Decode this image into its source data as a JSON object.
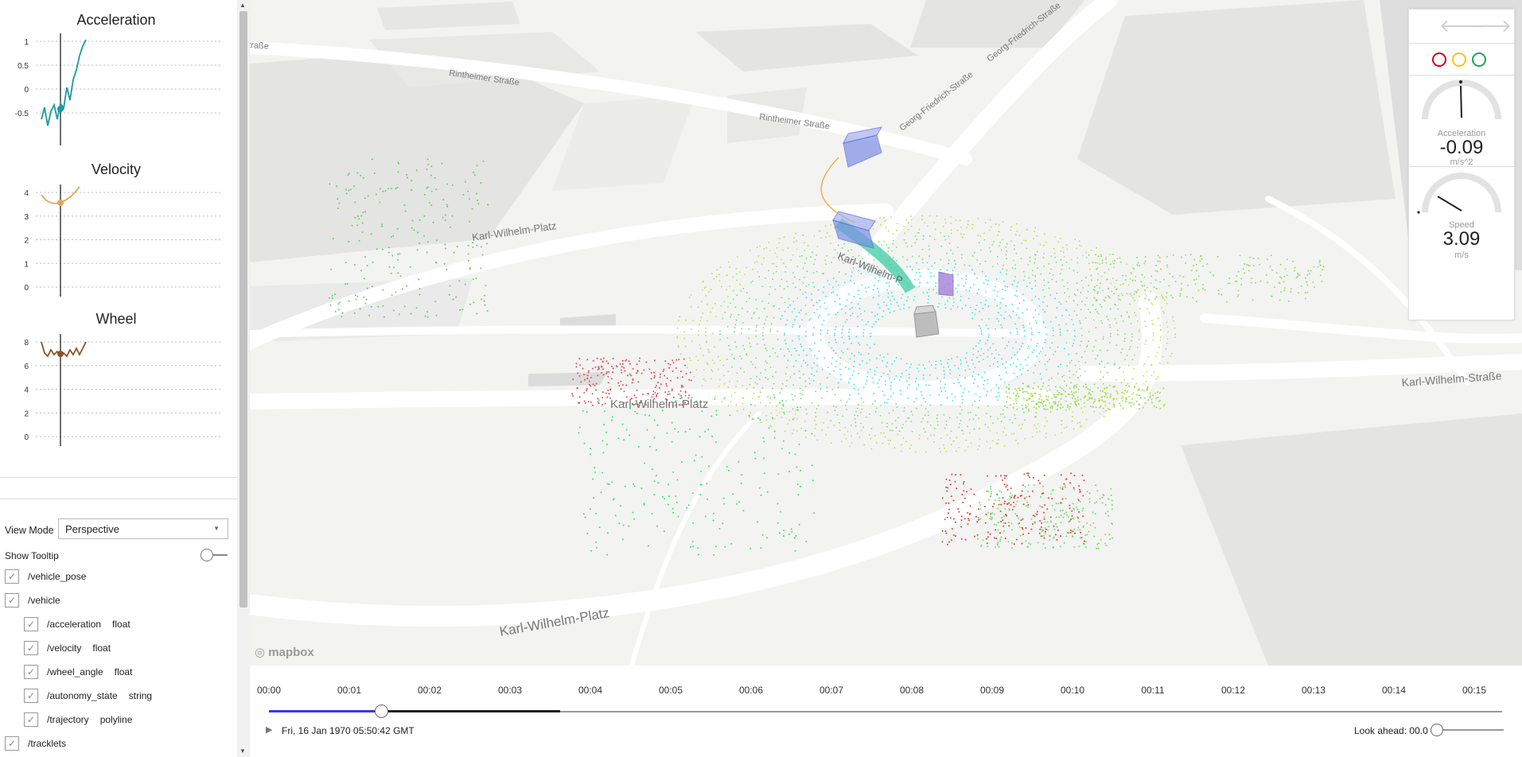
{
  "charts": [
    {
      "title": "Acceleration",
      "yticks": [
        "1",
        "0.5",
        "0",
        "-0.5"
      ],
      "color": "#1a9aa0"
    },
    {
      "title": "Velocity",
      "yticks": [
        "4",
        "3",
        "2",
        "1",
        "0"
      ],
      "color": "#e0a85e"
    },
    {
      "title": "Wheel",
      "yticks": [
        "8",
        "6",
        "4",
        "2",
        "0"
      ],
      "color": "#8b5428"
    }
  ],
  "controls": {
    "view_mode_label": "View Mode",
    "view_mode_value": "Perspective",
    "show_tooltip_label": "Show Tooltip",
    "streams": [
      {
        "name": "/vehicle_pose",
        "type": "",
        "checked": true,
        "indent": 0
      },
      {
        "name": "/vehicle",
        "type": "",
        "checked": true,
        "indent": 0
      },
      {
        "name": "/acceleration",
        "type": "float",
        "checked": true,
        "indent": 1
      },
      {
        "name": "/velocity",
        "type": "float",
        "checked": true,
        "indent": 1
      },
      {
        "name": "/wheel_angle",
        "type": "float",
        "checked": true,
        "indent": 1
      },
      {
        "name": "/autonomy_state",
        "type": "string",
        "checked": true,
        "indent": 1
      },
      {
        "name": "/trajectory",
        "type": "polyline",
        "checked": true,
        "indent": 1
      },
      {
        "name": "/tracklets",
        "type": "",
        "checked": true,
        "indent": 0
      }
    ]
  },
  "map": {
    "street_labels": [
      "Rintheimer Straße",
      "Rintheimer Straße",
      "Georg-Friedrich-Straße",
      "Georg-Friedrich-Straße",
      "Karl-Wilhelm-Platz",
      "Karl-Wilhelm-Platz",
      "Karl-Wilhelm-Platz",
      "Karl-Wilhelm-Straße",
      "Karl-Wilhelm-P",
      "traße"
    ],
    "attribution": "mapbox"
  },
  "hud": {
    "traffic_light_colors": [
      "#d0021b",
      "#f5c518",
      "#23a455"
    ],
    "acceleration_label": "Acceleration",
    "acceleration_value": "-0.09",
    "acceleration_unit": "m/s^2",
    "speed_label": "Speed",
    "speed_value": "3.09",
    "speed_unit": "m/s"
  },
  "timeline": {
    "ticks": [
      "00:00",
      "00:01",
      "00:02",
      "00:03",
      "00:04",
      "00:05",
      "00:06",
      "00:07",
      "00:08",
      "00:09",
      "00:10",
      "00:11",
      "00:12",
      "00:13",
      "00:14",
      "00:15"
    ],
    "current_time": "Fri, 16 Jan 1970 05:50:42 GMT",
    "look_ahead_label": "Look ahead: 00.0",
    "progress": 0.09
  }
}
